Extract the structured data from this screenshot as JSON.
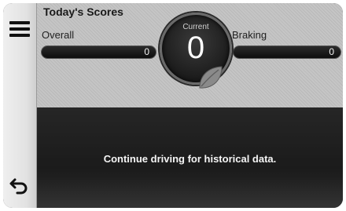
{
  "header": {
    "title": "Today's Scores"
  },
  "scores": {
    "overall": {
      "label": "Overall",
      "value": "0"
    },
    "braking": {
      "label": "Braking",
      "value": "0"
    },
    "current": {
      "label": "Current",
      "value": "0"
    }
  },
  "message": "Continue driving for historical data.",
  "icons": {
    "menu": "menu-icon",
    "back": "back-arrow-icon",
    "leaf": "leaf-icon"
  },
  "colors": {
    "bar_background": "#111111",
    "leaf": "#8a8a8a",
    "text_light": "#f5f5f5"
  }
}
